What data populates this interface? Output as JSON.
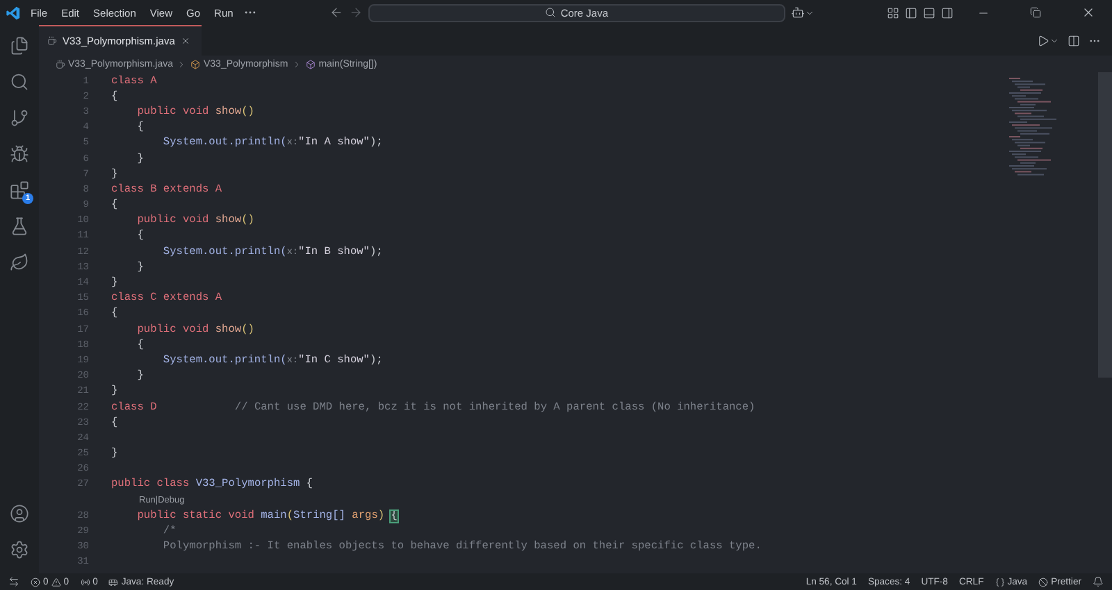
{
  "title_bar": {
    "menus": [
      "File",
      "Edit",
      "Selection",
      "View",
      "Go",
      "Run"
    ],
    "search": {
      "value": "Core Java"
    }
  },
  "activity_bar": {
    "extensions_badge": "1"
  },
  "tabs": [
    {
      "label": "V33_Polymorphism.java",
      "selected": true
    }
  ],
  "breadcrumb": [
    {
      "kind": "file",
      "label": "V33_Polymorphism.java"
    },
    {
      "kind": "class",
      "label": "V33_Polymorphism"
    },
    {
      "kind": "method",
      "label": "main(String[])"
    }
  ],
  "editor": {
    "lines": [
      {
        "kind": "code",
        "number": "1",
        "tokens": [
          {
            "kind": "kw",
            "text": "class A"
          }
        ]
      },
      {
        "kind": "code",
        "number": "2",
        "tokens": [
          {
            "kind": "punct",
            "text": "{"
          }
        ]
      },
      {
        "kind": "code",
        "number": "3",
        "tokens": [
          {
            "kind": "kw",
            "text": "    public void "
          },
          {
            "kind": "method",
            "text": "show"
          },
          {
            "kind": "paren",
            "text": "()"
          }
        ]
      },
      {
        "kind": "code",
        "number": "4",
        "tokens": [
          {
            "kind": "punct",
            "text": "    {"
          }
        ]
      },
      {
        "kind": "code",
        "number": "5",
        "tokens": [
          {
            "kind": "member",
            "text": "        System.out.println("
          },
          {
            "kind": "hint",
            "text": "x:"
          },
          {
            "kind": "string",
            "text": "\"In A show\""
          },
          {
            "kind": "punct",
            "text": ");"
          }
        ]
      },
      {
        "kind": "code",
        "number": "6",
        "tokens": [
          {
            "kind": "punct",
            "text": "    }"
          }
        ]
      },
      {
        "kind": "code",
        "number": "7",
        "tokens": [
          {
            "kind": "punct",
            "text": "}"
          }
        ]
      },
      {
        "kind": "code",
        "number": "8",
        "tokens": [
          {
            "kind": "kw",
            "text": "class B extends A"
          }
        ]
      },
      {
        "kind": "code",
        "number": "9",
        "tokens": [
          {
            "kind": "punct",
            "text": "{"
          }
        ]
      },
      {
        "kind": "code",
        "number": "10",
        "tokens": [
          {
            "kind": "kw",
            "text": "    public void "
          },
          {
            "kind": "method",
            "text": "show"
          },
          {
            "kind": "paren",
            "text": "()"
          }
        ]
      },
      {
        "kind": "code",
        "number": "11",
        "tokens": [
          {
            "kind": "punct",
            "text": "    {"
          }
        ]
      },
      {
        "kind": "code",
        "number": "12",
        "tokens": [
          {
            "kind": "member",
            "text": "        System.out.println("
          },
          {
            "kind": "hint",
            "text": "x:"
          },
          {
            "kind": "string",
            "text": "\"In B show\""
          },
          {
            "kind": "punct",
            "text": ");"
          }
        ]
      },
      {
        "kind": "code",
        "number": "13",
        "tokens": [
          {
            "kind": "punct",
            "text": "    }"
          }
        ]
      },
      {
        "kind": "code",
        "number": "14",
        "tokens": [
          {
            "kind": "punct",
            "text": "}"
          }
        ]
      },
      {
        "kind": "code",
        "number": "15",
        "tokens": [
          {
            "kind": "kw",
            "text": "class C extends A"
          }
        ]
      },
      {
        "kind": "code",
        "number": "16",
        "tokens": [
          {
            "kind": "punct",
            "text": "{"
          }
        ]
      },
      {
        "kind": "code",
        "number": "17",
        "tokens": [
          {
            "kind": "kw",
            "text": "    public void "
          },
          {
            "kind": "method",
            "text": "show"
          },
          {
            "kind": "paren",
            "text": "()"
          }
        ]
      },
      {
        "kind": "code",
        "number": "18",
        "tokens": [
          {
            "kind": "punct",
            "text": "    {"
          }
        ]
      },
      {
        "kind": "code",
        "number": "19",
        "tokens": [
          {
            "kind": "member",
            "text": "        System.out.println("
          },
          {
            "kind": "hint",
            "text": "x:"
          },
          {
            "kind": "string",
            "text": "\"In C show\""
          },
          {
            "kind": "punct",
            "text": ");"
          }
        ]
      },
      {
        "kind": "code",
        "number": "20",
        "tokens": [
          {
            "kind": "punct",
            "text": "    }"
          }
        ]
      },
      {
        "kind": "code",
        "number": "21",
        "tokens": [
          {
            "kind": "punct",
            "text": "}"
          }
        ]
      },
      {
        "kind": "code",
        "number": "22",
        "tokens": [
          {
            "kind": "kw",
            "text": "class D            "
          },
          {
            "kind": "comment",
            "text": "// Cant use DMD here, bcz it is not inherited by A parent class (No inheritance)"
          }
        ]
      },
      {
        "kind": "code",
        "number": "23",
        "tokens": [
          {
            "kind": "punct",
            "text": "{"
          }
        ]
      },
      {
        "kind": "code",
        "number": "24"
      },
      {
        "kind": "code",
        "number": "25",
        "tokens": [
          {
            "kind": "punct",
            "text": "}"
          }
        ]
      },
      {
        "kind": "code",
        "number": "26"
      },
      {
        "kind": "code",
        "number": "27",
        "tokens": [
          {
            "kind": "kw",
            "text": "public class "
          },
          {
            "kind": "member",
            "text": "V33_Polymorphism "
          },
          {
            "kind": "punct",
            "text": "{"
          }
        ]
      },
      {
        "kind": "lens",
        "text": "Run|Debug"
      },
      {
        "kind": "code",
        "number": "28",
        "tokens": [
          {
            "kind": "kw",
            "text": "    public static void "
          },
          {
            "kind": "member",
            "text": "main"
          },
          {
            "kind": "paren",
            "text": "("
          },
          {
            "kind": "member",
            "text": "String[] "
          },
          {
            "kind": "param",
            "text": "args"
          },
          {
            "kind": "paren",
            "text": ") "
          },
          {
            "kind": "matched",
            "text": "{"
          }
        ]
      },
      {
        "kind": "code",
        "number": "29",
        "tokens": [
          {
            "kind": "comment",
            "text": "        /*"
          }
        ]
      },
      {
        "kind": "code",
        "number": "30",
        "tokens": [
          {
            "kind": "comment",
            "text": "        Polymorphism :- It enables objects to behave differently based on their specific class type."
          }
        ]
      },
      {
        "kind": "code",
        "number": "31"
      }
    ]
  },
  "status_bar": {
    "errors": "0",
    "warnings": "0",
    "ports": "0",
    "java_status": "Java: Ready",
    "right": [
      {
        "kind": "text",
        "text": "Ln 56, Col 1"
      },
      {
        "kind": "text",
        "text": "Spaces: 4"
      },
      {
        "kind": "text",
        "text": "UTF-8"
      },
      {
        "kind": "text",
        "text": "CRLF"
      },
      {
        "kind": "language",
        "text": "Java"
      },
      {
        "kind": "formatter",
        "text": "Prettier"
      }
    ]
  }
}
